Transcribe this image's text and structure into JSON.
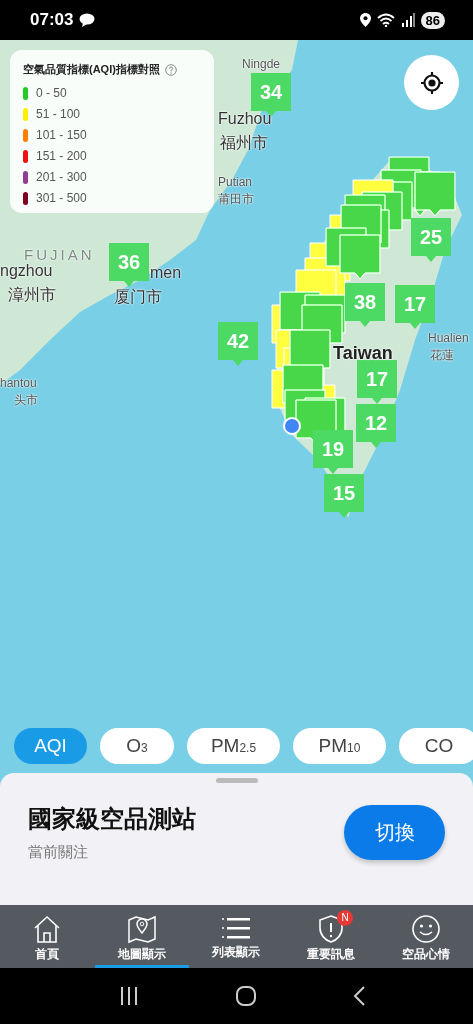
{
  "status_bar": {
    "time": "07:03",
    "battery": "86"
  },
  "map": {
    "labels": [
      {
        "text": "Ningde",
        "kind": "minor"
      },
      {
        "text": "Fuzhou",
        "kind": "city"
      },
      {
        "text": "福州市",
        "kind": "city"
      },
      {
        "text": "FUJIAN",
        "kind": "region"
      },
      {
        "text": "Putian",
        "kind": "minor"
      },
      {
        "text": "莆田市",
        "kind": "minor"
      },
      {
        "text": "ngzhou",
        "kind": "city"
      },
      {
        "text": "漳州市",
        "kind": "city"
      },
      {
        "text": "men",
        "kind": "city"
      },
      {
        "text": "厦门市",
        "kind": "city"
      },
      {
        "text": "hantou",
        "kind": "minor"
      },
      {
        "text": "头市",
        "kind": "minor"
      },
      {
        "text": "Taiwan",
        "kind": "country"
      },
      {
        "text": "Hualien",
        "kind": "minor"
      },
      {
        "text": "花蓮",
        "kind": "minor"
      }
    ],
    "markers": [
      {
        "value": "34",
        "color": "#4cd964"
      },
      {
        "value": "36",
        "color": "#4cd964"
      },
      {
        "value": "42",
        "color": "#4cd964"
      },
      {
        "value": "25",
        "color": "#4cd964"
      },
      {
        "value": "38",
        "color": "#4cd964"
      },
      {
        "value": "17",
        "color": "#4cd964"
      },
      {
        "value": "17",
        "color": "#4cd964"
      },
      {
        "value": "12",
        "color": "#4cd964"
      },
      {
        "value": "19",
        "color": "#4cd964"
      },
      {
        "value": "15",
        "color": "#4cd964"
      }
    ],
    "legend": {
      "title": "空氣品質指標(AQI)指標對照",
      "items": [
        {
          "range": "0 - 50",
          "color": "#22cc22"
        },
        {
          "range": "51 - 100",
          "color": "#ffee00"
        },
        {
          "range": "101 - 150",
          "color": "#ff7e00"
        },
        {
          "range": "151 - 200",
          "color": "#ee1111"
        },
        {
          "range": "201 - 300",
          "color": "#8f3f97"
        },
        {
          "range": "301 - 500",
          "color": "#7e0023"
        }
      ]
    }
  },
  "pollutant_tabs": [
    {
      "label": "AQI",
      "selected": true
    },
    {
      "label": "O$_{3}$",
      "selected": false
    },
    {
      "label": "PM$_{2.5}$",
      "selected": false
    },
    {
      "label": "PM$_{10}$",
      "selected": false
    },
    {
      "label": "CO",
      "selected": false
    }
  ],
  "sheet": {
    "title": "國家級空品測站",
    "subtitle": "當前關注",
    "button": "切換"
  },
  "nav": [
    {
      "label": "首頁",
      "kind": "home",
      "selected": false
    },
    {
      "label": "地圖顯示",
      "kind": "map",
      "selected": true
    },
    {
      "label": "列表顯示",
      "kind": "list",
      "selected": false
    },
    {
      "label": "重要訊息",
      "kind": "alert",
      "selected": false,
      "badge": "N"
    },
    {
      "label": "空品心情",
      "kind": "mood",
      "selected": false
    }
  ]
}
